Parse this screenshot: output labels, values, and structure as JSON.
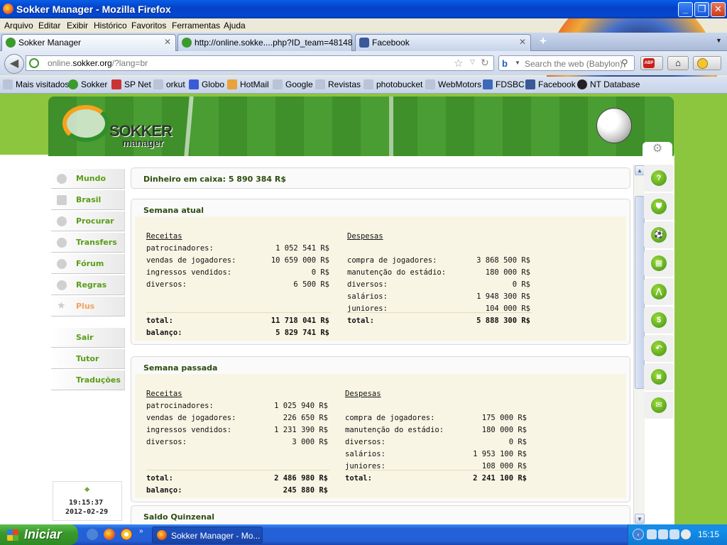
{
  "window": {
    "title": "Sokker Manager - Mozilla Firefox"
  },
  "menu": [
    "Arquivo",
    "Editar",
    "Exibir",
    "Histórico",
    "Favoritos",
    "Ferramentas",
    "Ajuda"
  ],
  "tabs": [
    {
      "label": "Sokker Manager",
      "active": true
    },
    {
      "label": "http://online.sokke....php?ID_team=48148",
      "active": false
    },
    {
      "label": "Facebook",
      "active": false
    }
  ],
  "nav": {
    "url_prefix": "online.",
    "url_domain": "sokker.org",
    "url_suffix": "/?lang=br",
    "search_placeholder": "Search the web (Babylon)",
    "abp_label": "ABP"
  },
  "bookmarks": [
    "Mais visitados",
    "Sokker",
    "SP Net",
    "orkut",
    "Globo",
    "HotMail",
    "Google",
    "Revistas",
    "photobucket",
    "WebMotors",
    "FDSBC",
    "Facebook",
    "NT Database"
  ],
  "site": {
    "logo": "SOKKER",
    "logo_sub": "manager",
    "menu": [
      {
        "label": "Mundo"
      },
      {
        "label": "Brasil"
      },
      {
        "label": "Procurar"
      },
      {
        "label": "Transfers"
      },
      {
        "label": "Fórum"
      },
      {
        "label": "Regras"
      },
      {
        "label": "Plus"
      }
    ],
    "menu2": [
      "Sair",
      "Tutor",
      "Traduções"
    ],
    "clock_time": "19:15:37",
    "clock_date": "2012-02-29"
  },
  "cash": "Dinheiro em caixa: 5 890 384 R$",
  "weeks": [
    {
      "title": "Semana atual",
      "receitas_label": "Receitas",
      "receitas": [
        {
          "k": "patrocinadores:",
          "v": "1 052 541 R$"
        },
        {
          "k": "vendas de jogadores:",
          "v": "10 659 000 R$"
        },
        {
          "k": "ingressos vendidos:",
          "v": "0 R$"
        },
        {
          "k": "diversos:",
          "v": "6 500 R$"
        }
      ],
      "receitas_total": {
        "k": "total:",
        "v": "11 718 041 R$"
      },
      "balanco": {
        "k": "balanço:",
        "v": "5 829 741 R$"
      },
      "despesas_label": "Despesas",
      "despesas": [
        {
          "k": "compra de jogadores:",
          "v": "3 868 500 R$"
        },
        {
          "k": "manutenção do estádio:",
          "v": "180 000 R$"
        },
        {
          "k": "diversos:",
          "v": "0 R$"
        },
        {
          "k": "salários:",
          "v": "1 948 300 R$"
        },
        {
          "k": "juniores:",
          "v": "104 000 R$"
        }
      ],
      "despesas_total": {
        "k": "total:",
        "v": "5 888 300 R$"
      }
    },
    {
      "title": "Semana passada",
      "receitas_label": "Receitas",
      "receitas": [
        {
          "k": "patrocinadores:",
          "v": "1 025 940 R$"
        },
        {
          "k": "vendas de jogadores:",
          "v": "226 650 R$"
        },
        {
          "k": "ingressos vendidos:",
          "v": "1 231 390 R$"
        },
        {
          "k": "diversos:",
          "v": "3 000 R$"
        }
      ],
      "receitas_total": {
        "k": "total:",
        "v": "2 486 980 R$"
      },
      "balanco": {
        "k": "balanço:",
        "v": "245 880 R$"
      },
      "despesas_label": "Despesas",
      "despesas": [
        {
          "k": "compra de jogadores:",
          "v": "175 000 R$"
        },
        {
          "k": "manutenção do estádio:",
          "v": "180 000 R$"
        },
        {
          "k": "diversos:",
          "v": "0 R$"
        },
        {
          "k": "salários:",
          "v": "1 953 100 R$"
        },
        {
          "k": "juniores:",
          "v": "108 000 R$"
        }
      ],
      "despesas_total": {
        "k": "total:",
        "v": "2 241 100 R$"
      }
    }
  ],
  "saldo_title": "Saldo Quinzenal",
  "right_icons": [
    "help-icon",
    "shield-icon",
    "player-icon",
    "tactics-icon",
    "training-icon",
    "money-icon",
    "arrow-icon",
    "camera-icon",
    "mail-icon"
  ],
  "taskbar": {
    "start": "Iniciar",
    "task": "Sokker Manager - Mo...",
    "clock": "15:15"
  }
}
